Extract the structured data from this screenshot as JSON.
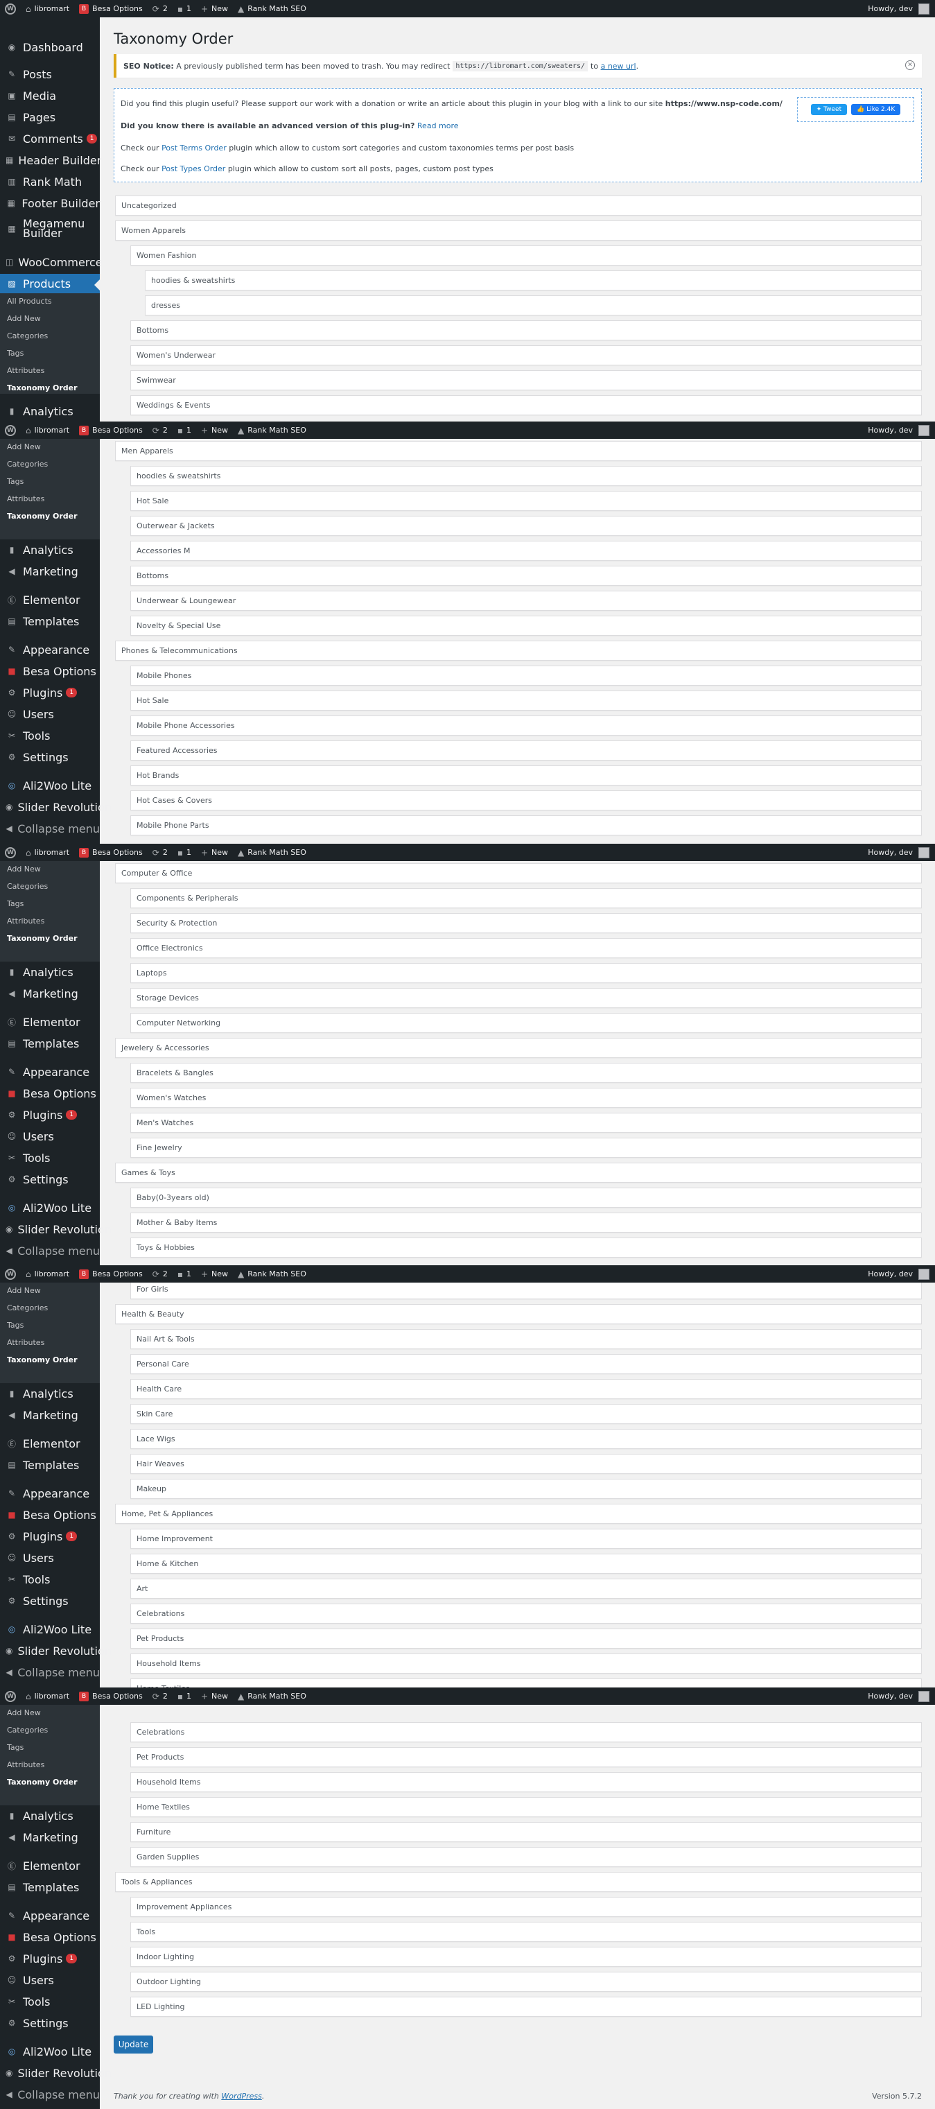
{
  "adminbar": {
    "site_name": "libromart",
    "besa_options": "Besa Options",
    "updates_count": "2",
    "comments_count": "1",
    "new_label": "New",
    "rank_math": "Rank Math SEO",
    "howdy": "Howdy, dev"
  },
  "sidebar": {
    "dashboard": "Dashboard",
    "posts": "Posts",
    "media": "Media",
    "pages": "Pages",
    "comments": "Comments",
    "comments_badge": "1",
    "header_builder": "Header Builder",
    "rank_math": "Rank Math",
    "footer_builder": "Footer Builder",
    "megamenu_builder": "Megamenu Builder",
    "woocommerce": "WooCommerce",
    "products": "Products",
    "sub": {
      "all_products": "All Products",
      "add_new": "Add New",
      "categories": "Categories",
      "tags": "Tags",
      "attributes": "Attributes",
      "taxonomy_order": "Taxonomy Order"
    },
    "analytics": "Analytics",
    "marketing": "Marketing",
    "elementor": "Elementor",
    "templates": "Templates",
    "appearance": "Appearance",
    "besa_options": "Besa Options",
    "plugins": "Plugins",
    "plugins_badge": "1",
    "users": "Users",
    "tools": "Tools",
    "settings": "Settings",
    "ali2woo": "Ali2Woo Lite",
    "slider_revolution": "Slider Revolution",
    "collapse_menu": "Collapse menu"
  },
  "page": {
    "title": "Taxonomy Order",
    "notice": {
      "label": "SEO Notice:",
      "text": "A previously published term has been moved to trash. You may redirect",
      "url": "https://libromart.com/sweaters/",
      "to": "to",
      "link": "a new url",
      "end": "."
    },
    "info": {
      "line1": "Did you find this plugin useful? Please support our work with a donation or write an article about this plugin in your blog with a link to our site",
      "line1_site": "https://www.nsp-code.com/",
      "line2": "Did you know there is available an advanced version of this plug-in?",
      "line2_link": "Read more",
      "line3_pre": "Check our",
      "line3_link": "Post Terms Order",
      "line3_post": "plugin which allow to custom sort categories and custom taxonomies terms per post basis",
      "line4_pre": "Check our",
      "line4_link": "Post Types Order",
      "line4_post": "plugin which allow to custom sort all posts, pages, custom post types",
      "tweet": "Tweet",
      "like": "Like 2.4K"
    },
    "update_button": "Update",
    "footer_text": "Thank you for creating with",
    "footer_link": "WordPress",
    "footer_end": ".",
    "version": "Version 5.7.2"
  },
  "segments": [
    {
      "rows": [
        {
          "t": "Uncategorized",
          "d": 0
        },
        {
          "t": "Women Apparels",
          "d": 0
        },
        {
          "t": "Women Fashion",
          "d": 1
        },
        {
          "t": "hoodies & sweatshirts",
          "d": 2
        },
        {
          "t": "dresses",
          "d": 2
        },
        {
          "t": "Bottoms",
          "d": 1
        },
        {
          "t": "Women's Underwear",
          "d": 1
        },
        {
          "t": "Swimwear",
          "d": 1
        },
        {
          "t": "Weddings & Events",
          "d": 1
        }
      ]
    },
    {
      "rows": [
        {
          "t": "Men Apparels",
          "d": 0
        },
        {
          "t": "hoodies & sweatshirts",
          "d": 1
        },
        {
          "t": "Hot Sale",
          "d": 1
        },
        {
          "t": "Outerwear & Jackets",
          "d": 1
        },
        {
          "t": "Accessories M",
          "d": 1
        },
        {
          "t": "Bottoms",
          "d": 1
        },
        {
          "t": "Underwear & Loungewear",
          "d": 1
        },
        {
          "t": "Novelty & Special Use",
          "d": 1
        },
        {
          "t": "Phones & Telecommunications",
          "d": 0
        },
        {
          "t": "Mobile Phones",
          "d": 1
        },
        {
          "t": "Hot Sale",
          "d": 1
        },
        {
          "t": "Mobile Phone Accessories",
          "d": 1
        },
        {
          "t": "Featured Accessories",
          "d": 1
        },
        {
          "t": "Hot Brands",
          "d": 1
        },
        {
          "t": "Hot Cases & Covers",
          "d": 1
        },
        {
          "t": "Mobile Phone Parts",
          "d": 1
        }
      ]
    },
    {
      "rows": [
        {
          "t": "Computer & Office",
          "d": 0
        },
        {
          "t": "Components & Peripherals",
          "d": 1
        },
        {
          "t": "Security & Protection",
          "d": 1
        },
        {
          "t": "Office Electronics",
          "d": 1
        },
        {
          "t": "Laptops",
          "d": 1
        },
        {
          "t": "Storage Devices",
          "d": 1
        },
        {
          "t": "Computer Networking",
          "d": 1
        },
        {
          "t": "Jewelery & Accessories",
          "d": 0
        },
        {
          "t": "Bracelets & Bangles",
          "d": 1
        },
        {
          "t": "Women's Watches",
          "d": 1
        },
        {
          "t": "Men's Watches",
          "d": 1
        },
        {
          "t": "Fine Jewelry",
          "d": 1
        },
        {
          "t": "Games & Toys",
          "d": 0
        },
        {
          "t": "Baby(0-3years old)",
          "d": 1
        },
        {
          "t": "Mother & Baby Items",
          "d": 1
        },
        {
          "t": "Toys & Hobbies",
          "d": 1
        }
      ]
    },
    {
      "rows": [
        {
          "t": "For Girls",
          "d": 1
        },
        {
          "t": "Health & Beauty",
          "d": 0
        },
        {
          "t": "Nail Art & Tools",
          "d": 1
        },
        {
          "t": "Personal Care",
          "d": 1
        },
        {
          "t": "Health Care",
          "d": 1
        },
        {
          "t": "Skin Care",
          "d": 1
        },
        {
          "t": "Lace Wigs",
          "d": 1
        },
        {
          "t": "Hair Weaves",
          "d": 1
        },
        {
          "t": "Makeup",
          "d": 1
        },
        {
          "t": "Home, Pet & Appliances",
          "d": 0
        },
        {
          "t": "Home Improvement",
          "d": 1
        },
        {
          "t": "Home & Kitchen",
          "d": 1
        },
        {
          "t": "Art",
          "d": 1
        },
        {
          "t": "Celebrations",
          "d": 1
        },
        {
          "t": "Pet Products",
          "d": 1
        },
        {
          "t": "Household Items",
          "d": 1
        },
        {
          "t": "Home Textiles",
          "d": 1
        }
      ]
    },
    {
      "rows": [
        {
          "t": "Celebrations",
          "d": 1
        },
        {
          "t": "Pet Products",
          "d": 1
        },
        {
          "t": "Household Items",
          "d": 1
        },
        {
          "t": "Home Textiles",
          "d": 1
        },
        {
          "t": "Furniture",
          "d": 1
        },
        {
          "t": "Garden Supplies",
          "d": 1
        },
        {
          "t": "Tools & Appliances",
          "d": 0
        },
        {
          "t": "Improvement Appliances",
          "d": 1
        },
        {
          "t": "Tools",
          "d": 1
        },
        {
          "t": "Indoor Lighting",
          "d": 1
        },
        {
          "t": "Outdoor Lighting",
          "d": 1
        },
        {
          "t": "LED Lighting",
          "d": 1
        }
      ]
    }
  ],
  "colors": {
    "admin_bar": "#1d2327",
    "sidebar": "#1d2327",
    "submenu": "#2c3338",
    "accent": "#2271b1",
    "badge": "#d63638",
    "notice_border": "#dba617",
    "background": "#f1f1f1"
  }
}
